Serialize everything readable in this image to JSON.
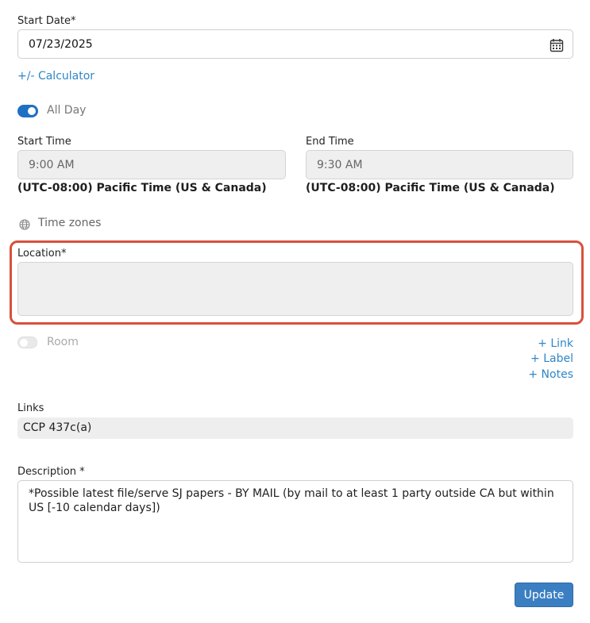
{
  "start_date": {
    "label": "Start Date*",
    "value": "07/23/2025",
    "icon": "calendar-icon"
  },
  "calculator_link": "+/- Calculator",
  "all_day": {
    "label": "All Day",
    "on": true
  },
  "start_time": {
    "label": "Start Time",
    "value": "9:00 AM",
    "timezone": "(UTC-08:00) Pacific Time (US & Canada)"
  },
  "end_time": {
    "label": "End Time",
    "value": "9:30 AM",
    "timezone": "(UTC-08:00) Pacific Time (US & Canada)"
  },
  "time_zones": {
    "label": "Time zones",
    "icon": "globe-icon"
  },
  "location": {
    "label": "Location*",
    "value": "",
    "highlight_color": "#d9503a"
  },
  "room": {
    "label": "Room",
    "on": false
  },
  "actions": {
    "link": "+ Link",
    "label": "+ Label",
    "notes": "+ Notes"
  },
  "links": {
    "label": "Links",
    "value": "CCP 437c(a)"
  },
  "description": {
    "label": "Description *",
    "value": "*Possible latest file/serve SJ papers - BY MAIL  (by mail to at least 1 party outside CA but within US [-10 calendar days])"
  },
  "update_button": "Update"
}
